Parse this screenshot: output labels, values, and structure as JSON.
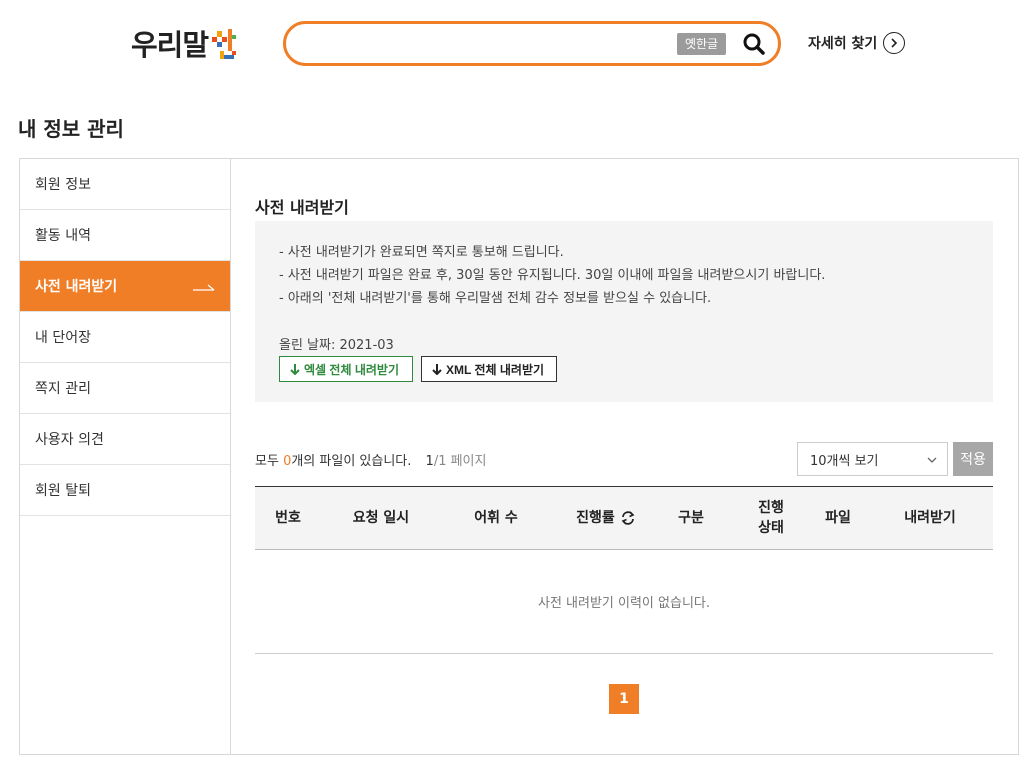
{
  "header": {
    "logo_text": "우리말",
    "logo_mark": "샘",
    "search": {
      "value": "",
      "placeholder": ""
    },
    "oldhangul_label": "옛한글",
    "advanced_label": "자세히 찾기"
  },
  "page_title": "내 정보 관리",
  "sidebar": {
    "items": [
      {
        "label": "회원 정보"
      },
      {
        "label": "활동 내역"
      },
      {
        "label": "사전 내려받기"
      },
      {
        "label": "내 단어장"
      },
      {
        "label": "쪽지 관리"
      },
      {
        "label": "사용자 의견"
      },
      {
        "label": "회원 탈퇴"
      }
    ],
    "active_index": 2
  },
  "section": {
    "title": "사전 내려받기",
    "notices": [
      "- 사전 내려받기가 완료되면 쪽지로 통보해 드립니다.",
      "- 사전 내려받기 파일은 완료 후, 30일 동안 유지됩니다. 30일 이내에 파일을 내려받으시기 바랍니다.",
      "- 아래의 '전체 내려받기'를 통해 우리말샘 전체 감수 정보를 받으실 수 있습니다."
    ],
    "date_text": "올린 날짜: 2021-03",
    "excel_button": "엑셀 전체 내려받기",
    "xml_button": "XML 전체 내려받기"
  },
  "list": {
    "count_prefix": "모두 ",
    "count_value": "0",
    "count_suffix": "개의 파일이 있습니다.",
    "page_current": "1",
    "page_total": "/1 페이지",
    "select_value": "10개씩 보기",
    "apply_label": "적용",
    "columns": [
      "번호",
      "요청 일시",
      "어휘 수",
      "진행률",
      "구분",
      "진행\n상태",
      "파일",
      "내려받기"
    ],
    "empty_message": "사전 내려받기 이력이 없습니다.",
    "pagination": [
      "1"
    ]
  },
  "colors": {
    "accent": "#f07e27",
    "excel_green": "#2f8a3e"
  }
}
